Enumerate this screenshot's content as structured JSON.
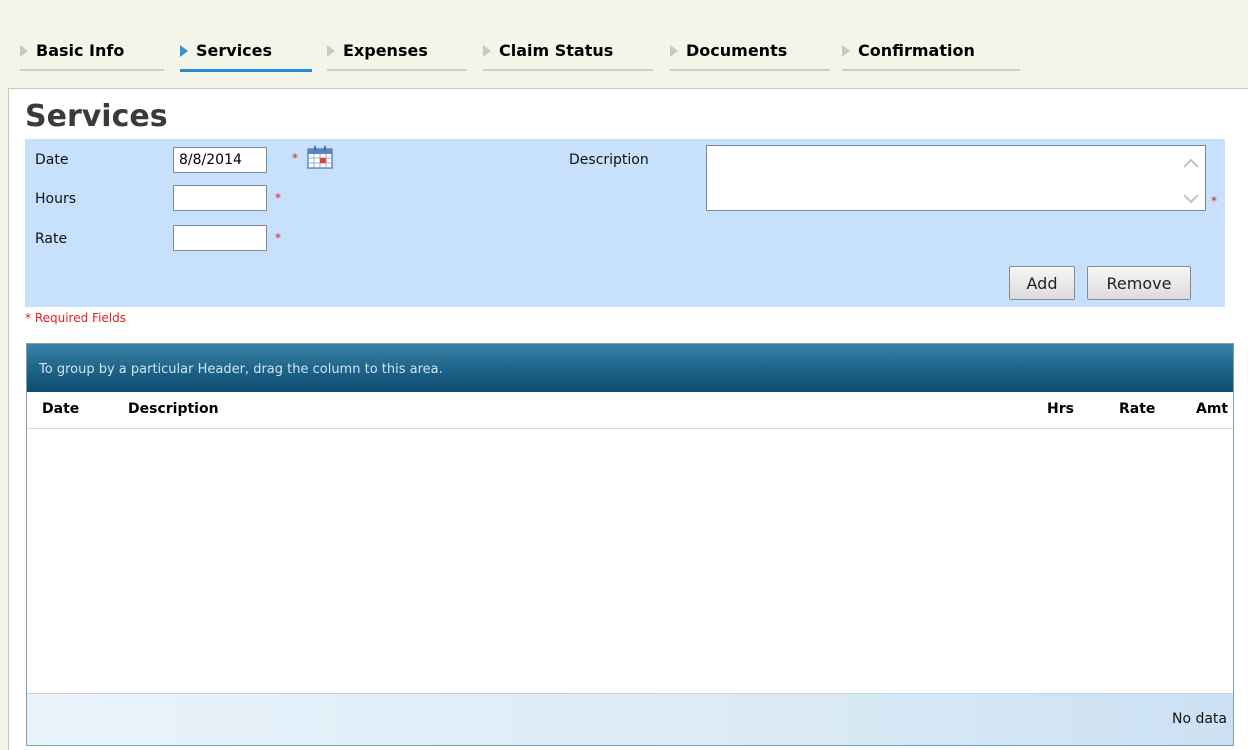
{
  "tabs": [
    {
      "label": "Basic Info",
      "active": false
    },
    {
      "label": "Services",
      "active": true
    },
    {
      "label": "Expenses",
      "active": false
    },
    {
      "label": "Claim Status",
      "active": false
    },
    {
      "label": "Documents",
      "active": false
    },
    {
      "label": "Confirmation",
      "active": false
    }
  ],
  "page": {
    "title": "Services"
  },
  "form": {
    "date_label": "Date",
    "date_value": "8/8/2014",
    "hours_label": "Hours",
    "hours_value": "",
    "rate_label": "Rate",
    "rate_value": "",
    "description_label": "Description",
    "description_value": "",
    "required_marker": "*",
    "add_label": "Add",
    "remove_label": "Remove",
    "required_note": "* Required Fields"
  },
  "grid": {
    "group_hint": "To group by a particular Header, drag the column to this area.",
    "columns": [
      "Date",
      "Description",
      "Hrs",
      "Rate",
      "Amt"
    ],
    "rows": [],
    "empty_text": "No data"
  },
  "colors": {
    "form_background": "#c7e0fb",
    "active_tab_underline": "#2e8ad8",
    "required_red": "#e02020",
    "grid_header_blue": "#1d6288"
  },
  "icons": [
    "tab-arrow-icon",
    "calendar-icon",
    "scroll-up-icon",
    "scroll-down-icon"
  ]
}
